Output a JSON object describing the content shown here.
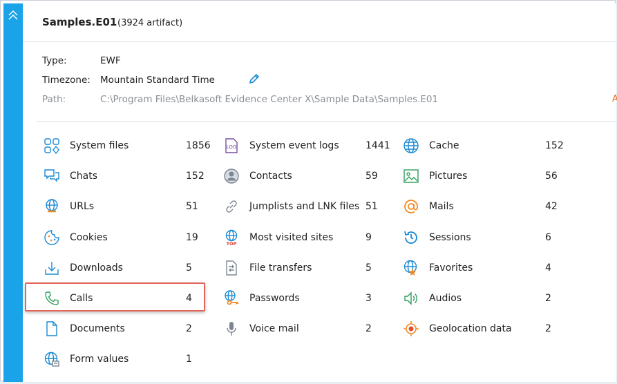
{
  "header": {
    "title": "Samples.E01",
    "artifact_count": "(3924 artifact)"
  },
  "meta": {
    "type_label": "Type:",
    "type_value": "EWF",
    "timezone_label": "Timezone:",
    "timezone_value": "Mountain Standard Time",
    "path_label": "Path:",
    "path_value": "C:\\Program Files\\Belkasoft Evidence Center X\\Sample Data\\Samples.E01",
    "truncated_link": "A"
  },
  "colors": {
    "accent": "#1aa3e8",
    "highlight": "#e4655a",
    "icon_blue": "#1a8ad4",
    "icon_orange": "#f08a24",
    "icon_green": "#2e9e5b"
  },
  "categories": {
    "col1": [
      {
        "label": "System files",
        "count": "1856",
        "icon": "system-files-icon"
      },
      {
        "label": "Chats",
        "count": "152",
        "icon": "chats-icon"
      },
      {
        "label": "URLs",
        "count": "51",
        "icon": "urls-icon"
      },
      {
        "label": "Cookies",
        "count": "19",
        "icon": "cookies-icon"
      },
      {
        "label": "Downloads",
        "count": "5",
        "icon": "downloads-icon"
      },
      {
        "label": "Calls",
        "count": "4",
        "icon": "phone-icon"
      },
      {
        "label": "Documents",
        "count": "2",
        "icon": "document-icon"
      },
      {
        "label": "Form values",
        "count": "1",
        "icon": "form-values-icon"
      }
    ],
    "col2": [
      {
        "label": "System event logs",
        "count": "1441",
        "icon": "log-icon",
        "icon_text": "LOG"
      },
      {
        "label": "Contacts",
        "count": "59",
        "icon": "contacts-icon"
      },
      {
        "label": "Jumplists and LNK files",
        "count": "51",
        "icon": "link-icon"
      },
      {
        "label": "Most visited sites",
        "count": "9",
        "icon": "top-sites-icon",
        "icon_text": "TOP"
      },
      {
        "label": "File transfers",
        "count": "5",
        "icon": "file-transfer-icon"
      },
      {
        "label": "Passwords",
        "count": "3",
        "icon": "password-key-icon"
      },
      {
        "label": "Voice mail",
        "count": "2",
        "icon": "microphone-icon"
      }
    ],
    "col3": [
      {
        "label": "Cache",
        "count": "152",
        "icon": "cache-globe-icon"
      },
      {
        "label": "Pictures",
        "count": "56",
        "icon": "picture-icon"
      },
      {
        "label": "Mails",
        "count": "42",
        "icon": "mail-at-icon"
      },
      {
        "label": "Sessions",
        "count": "6",
        "icon": "history-icon"
      },
      {
        "label": "Favorites",
        "count": "4",
        "icon": "favorites-star-icon"
      },
      {
        "label": "Audios",
        "count": "2",
        "icon": "speaker-icon"
      },
      {
        "label": "Geolocation data",
        "count": "2",
        "icon": "geolocation-icon"
      }
    ]
  }
}
